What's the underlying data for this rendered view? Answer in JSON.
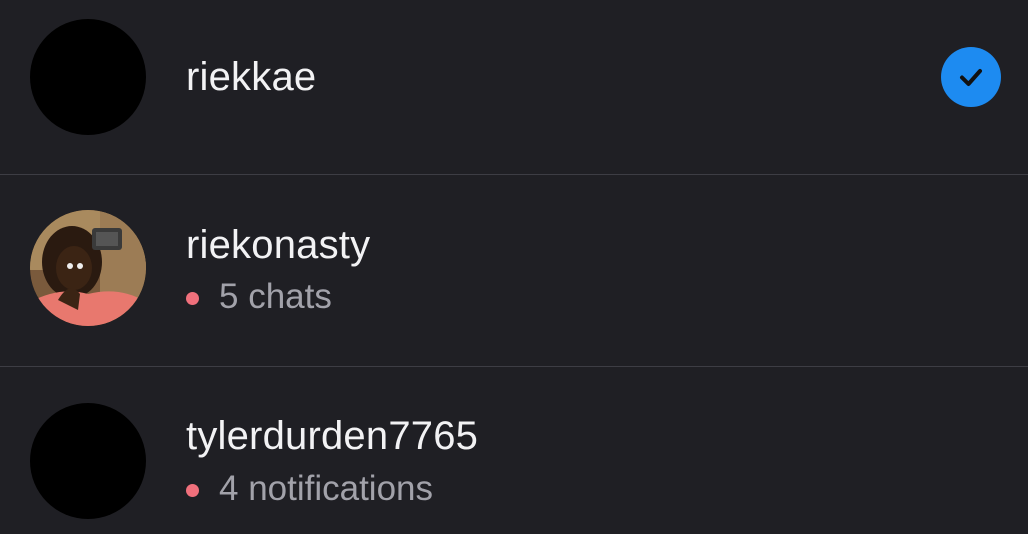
{
  "colors": {
    "background": "#1f1f24",
    "divider": "#3d3d44",
    "username": "#f2f2f4",
    "status_text": "#a2a2aa",
    "status_dot": "#f0707c",
    "check_badge": "#1d8bf1"
  },
  "accounts": [
    {
      "username": "riekkae",
      "avatar": "blank-avatar",
      "selected": true,
      "status": null
    },
    {
      "username": "riekonasty",
      "avatar": "profile-photo",
      "selected": false,
      "status": "5 chats"
    },
    {
      "username": "tylerdurden7765",
      "avatar": "blank-avatar",
      "selected": false,
      "status": "4 notifications"
    }
  ]
}
